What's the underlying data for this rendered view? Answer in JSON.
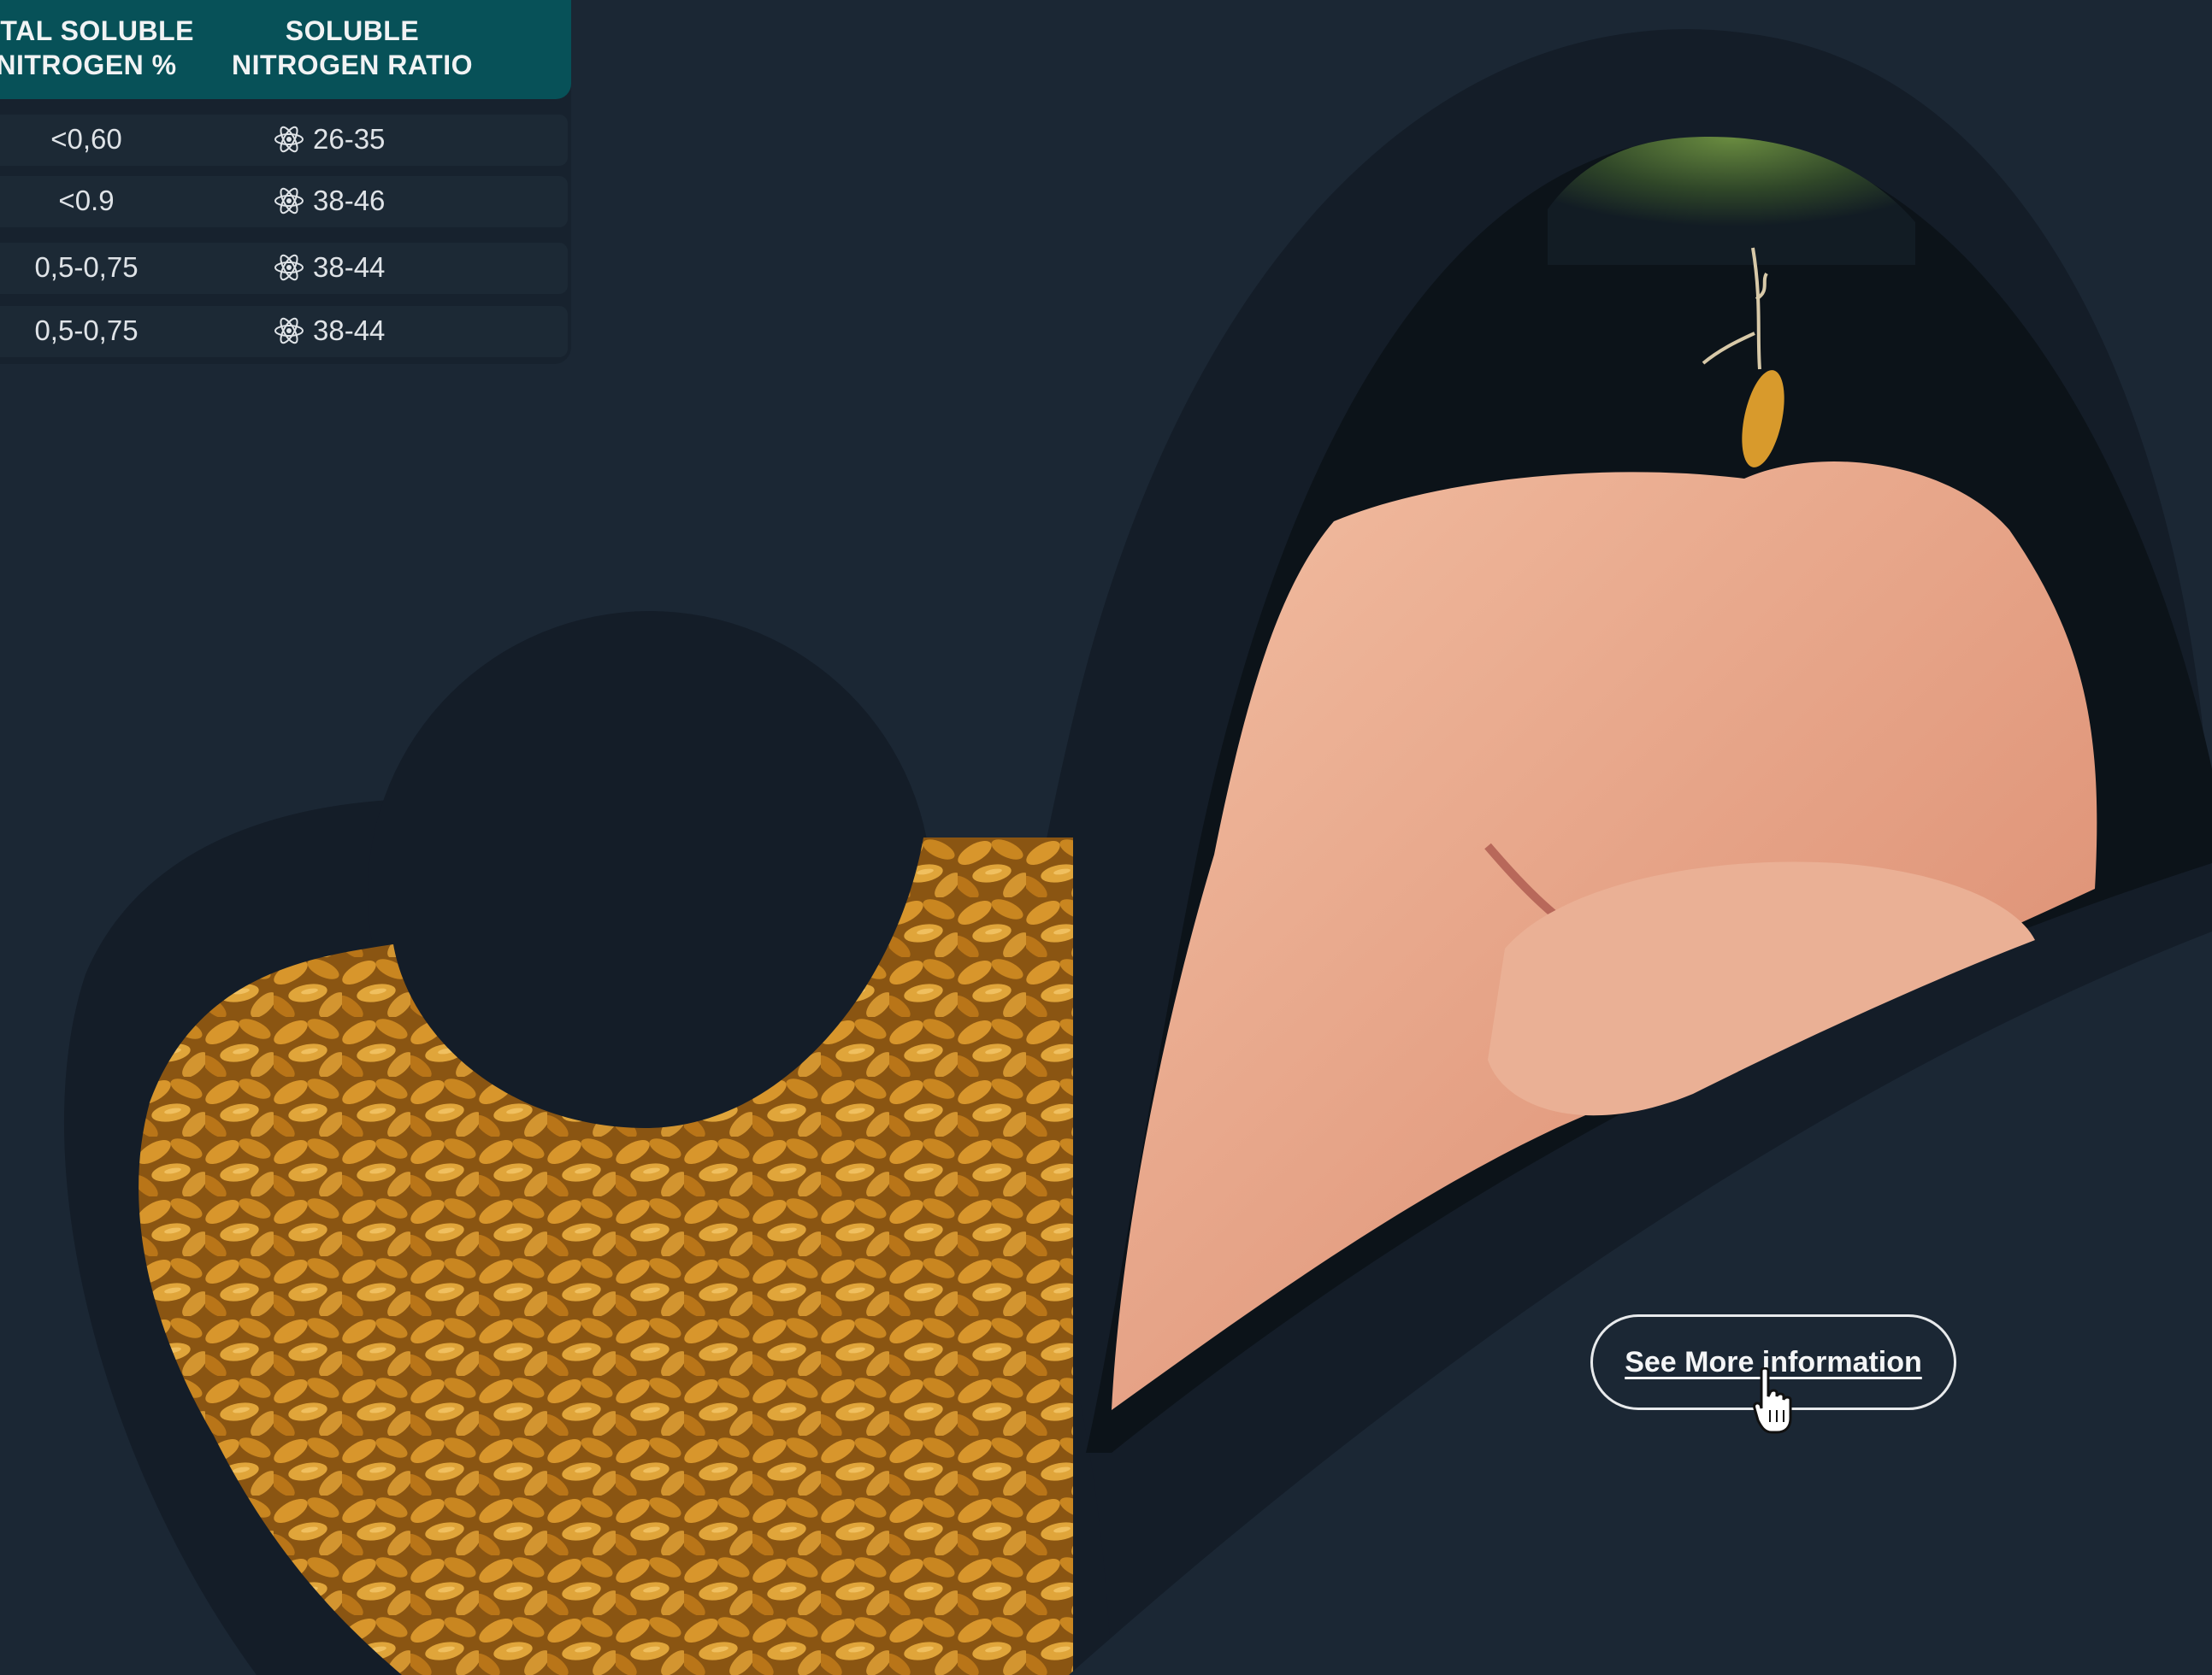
{
  "colors": {
    "background": "#1b2734",
    "dark_shape": "#141d28",
    "table_header": "#075158",
    "table_row": "#1c2935",
    "text_light": "#f1f3f4",
    "grain": "#c98d28",
    "skin": "#e9ad8f"
  },
  "table": {
    "headers": [
      "OTAL SOLUBLE\nNITROGEN %",
      "SOLUBLE\nNITROGEN RATIO"
    ],
    "rows": [
      {
        "total_soluble_nitrogen": "<0,60",
        "ratio": "26-35"
      },
      {
        "total_soluble_nitrogen": "<0.9",
        "ratio": "38-46"
      },
      {
        "total_soluble_nitrogen": "0,5-0,75",
        "ratio": "38-44"
      },
      {
        "total_soluble_nitrogen": "0,5-0,75",
        "ratio": "38-44"
      }
    ],
    "ratio_icon": "atom-icon"
  },
  "cta": {
    "label": "See More information"
  },
  "cursor_icon": "hand-pointer-icon"
}
